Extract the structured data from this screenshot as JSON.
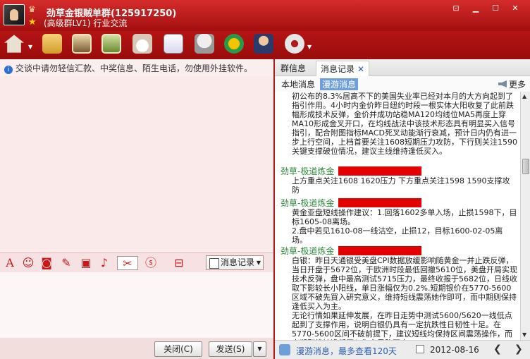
{
  "window": {
    "group_name": "劲草金银贼单群(125917250)",
    "group_level": "(高级群LV1)",
    "group_category": "行业交流"
  },
  "toolbar": {
    "icons": [
      "home-icon",
      "folder-icon",
      "album-icon",
      "video-icon",
      "coffee-icon",
      "notes-icon",
      "microphone-icon",
      "share-icon",
      "admin-icon",
      "gear-icon"
    ]
  },
  "left": {
    "notice": "交谈中请勿轻信汇款、中奖信息、陌生电话，勿使用外挂软件。",
    "history_button": "消息记录",
    "close_button": "关闭(C)",
    "send_button": "发送(S)"
  },
  "right": {
    "tabs": [
      "群信息",
      "消息记录"
    ],
    "subtabs": [
      "本地消息",
      "漫游消息"
    ],
    "more": "更多",
    "messages": [
      {
        "sender": "",
        "text": "初公布的8.3%居高不下的美国失业率已经对本月的大方向起到了指引作用。4小时内金价昨日纽约时段一根实体大阳收复了此前跌幅形成技术反弹，金价并成功站稳MA120均线位MA5再度上穿MA10形成金叉开口，在均线战法中该技术形态具有明显买入信号指引，配合附图指标MACD死叉动能渐行衰减，预计日内仍有进一步上行空间，上档首要关注1608短期压力攻防，下行则关注1590关键支撑破位情况，建议主线维持逢低买入。"
      },
      {
        "sender": "劲草-极道炼金",
        "text": "上方重点关注1608 1620压力 下方重点关注1598 1590支撑攻防"
      },
      {
        "sender": "劲草-极道炼金",
        "text": "黄金亚盘短线操作建议：1.回落1602多单入场，止损1598下，目标1605-08离场。\n2.盘中若见1610-08一线沽空，止损12，目标1600-02-05离场。"
      },
      {
        "sender": "劲草-极道炼金",
        "text": "白银：昨日天通银受美盘CPI数据放缓影响随黄金一并止跌反弹，当日开盘于5672位，于欧洲时段最低回撤5610位，美盘开局实现技术反弹，盘中最高测试5715压力，最终收报于5682位，日线收取下影较长小阳线，单日涨幅仅为0.2%.短期银价在5770-5600区域不破先買入研究意义，维持短线震荡她作即可，而中期则保持逢低买入为主。\n无论行情如果延伸发展，在昨日走势中测试5600/5620一线低点起到了支撑作用，说明白银仍具有一定抗跌性日韧性十足。在5770-5600区间不破前提下，建议短线均保持区间震荡操作，而中期则维持逢低买入为主思路不变。"
      }
    ],
    "footer_text": "漫游消息，最多查看120天",
    "date": "2012-08-16"
  }
}
